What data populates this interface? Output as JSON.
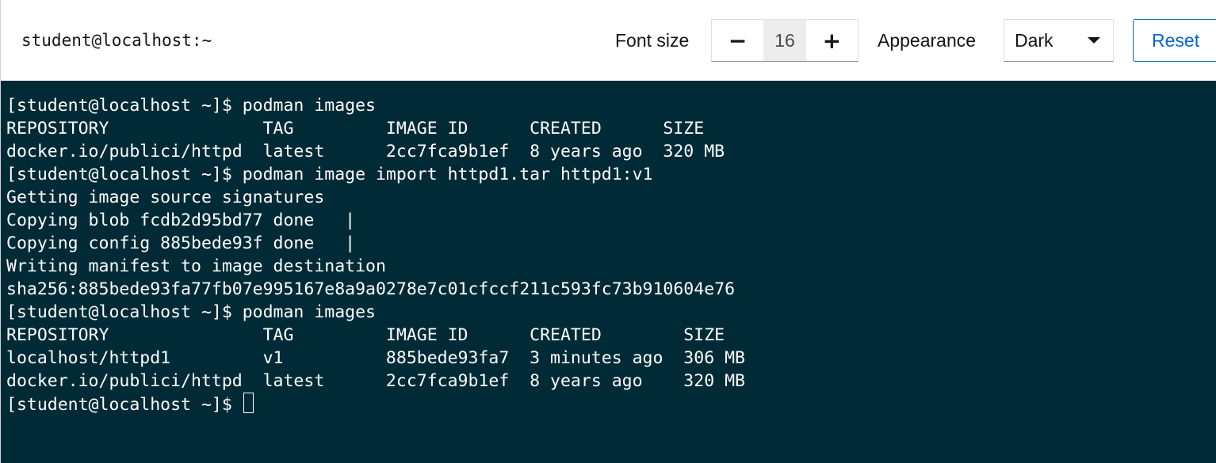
{
  "window": {
    "title": "student@localhost:~"
  },
  "toolbar": {
    "font_size_label": "Font size",
    "decrease_symbol": "−",
    "font_size_value": "16",
    "increase_symbol": "+",
    "appearance_label": "Appearance",
    "appearance_value": "Dark",
    "reset_label": "Reset"
  },
  "terminal": {
    "background": "#002b36",
    "foreground": "#ffffff",
    "lines": [
      "[student@localhost ~]$ podman images",
      "REPOSITORY               TAG         IMAGE ID      CREATED      SIZE",
      "docker.io/publici/httpd  latest      2cc7fca9b1ef  8 years ago  320 MB",
      "[student@localhost ~]$ podman image import httpd1.tar httpd1:v1",
      "Getting image source signatures",
      "Copying blob fcdb2d95bd77 done   |",
      "Copying config 885bede93f done   |",
      "Writing manifest to image destination",
      "sha256:885bede93fa77fb07e995167e8a9a0278e7c01cfccf211c593fc73b910604e76",
      "[student@localhost ~]$ podman images",
      "REPOSITORY               TAG         IMAGE ID      CREATED        SIZE",
      "localhost/httpd1         v1          885bede93fa7  3 minutes ago  306 MB",
      "docker.io/publici/httpd  latest      2cc7fca9b1ef  8 years ago    320 MB"
    ],
    "prompt": "[student@localhost ~]$ "
  }
}
